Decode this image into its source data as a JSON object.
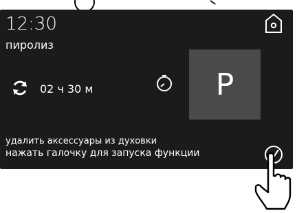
{
  "screen": {
    "time": "12:30",
    "mode": "пиролиз",
    "duration": "02 ч 30 м",
    "program_letter": "P",
    "hint_line1": "удалить аксессуары из духовки",
    "hint_line2": "нажать галочку для запуска функции"
  },
  "icons": {
    "home": "home-icon",
    "cycle": "cycle-icon",
    "timer": "stopwatch-icon",
    "confirm": "checkmark-icon",
    "hand": "pointing-hand-icon"
  },
  "colors": {
    "background": "#1b1b1b",
    "program_box": "#4a4a4a",
    "text": "#ffffff"
  }
}
